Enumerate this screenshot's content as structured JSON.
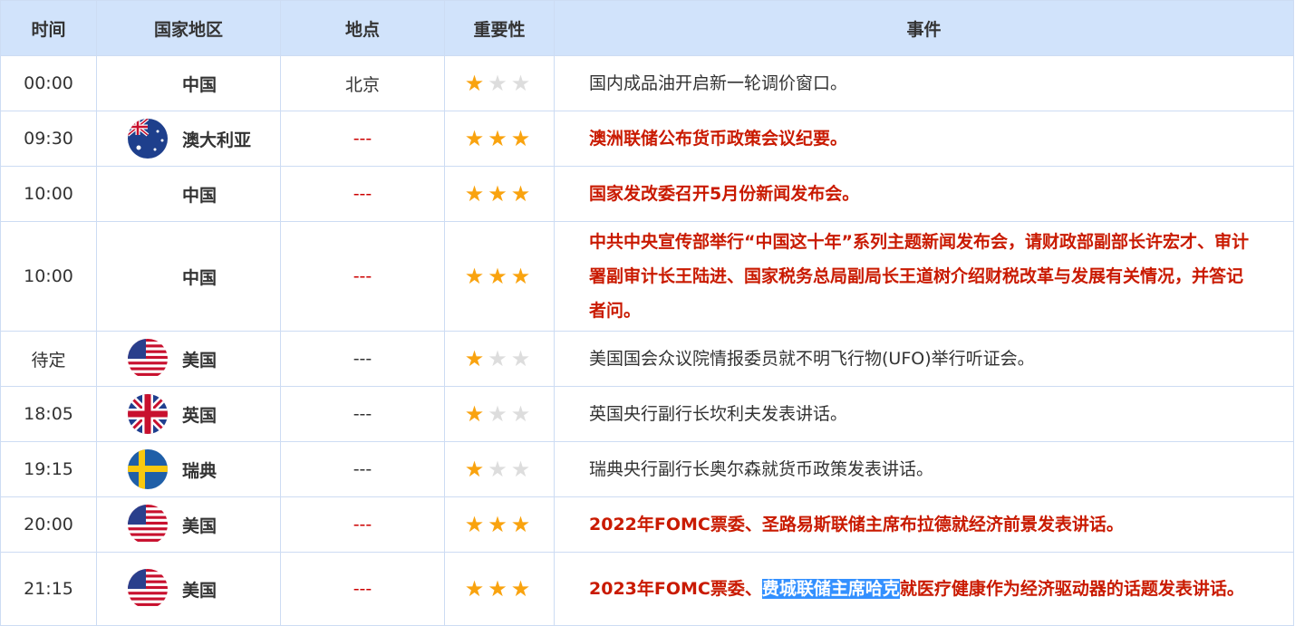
{
  "headers": [
    "时间",
    "国家地区",
    "地点",
    "重要性",
    "事件"
  ],
  "rows": [
    {
      "time": "00:00",
      "country": "中国",
      "flag": "none",
      "location": "北京",
      "stars": 1,
      "important": false,
      "event": "国内成品油开启新一轮调价窗口。"
    },
    {
      "time": "09:30",
      "country": "澳大利亚",
      "flag": "au",
      "location": "---",
      "stars": 3,
      "important": true,
      "event": "澳洲联储公布货币政策会议纪要。"
    },
    {
      "time": "10:00",
      "country": "中国",
      "flag": "none",
      "location": "---",
      "stars": 3,
      "important": true,
      "event": "国家发改委召开5月份新闻发布会。"
    },
    {
      "time": "10:00",
      "country": "中国",
      "flag": "none",
      "location": "---",
      "stars": 3,
      "important": true,
      "event": "中共中央宣传部举行“中国这十年”系列主题新闻发布会，请财政部副部长许宏才、审计署副审计长王陆进、国家税务总局副局长王道树介绍财税改革与发展有关情况，并答记者问。"
    },
    {
      "time": "待定",
      "country": "美国",
      "flag": "us",
      "location": "---",
      "stars": 1,
      "important": false,
      "event": "美国国会众议院情报委员就不明飞行物(UFO)举行听证会。"
    },
    {
      "time": "18:05",
      "country": "英国",
      "flag": "uk",
      "location": "---",
      "stars": 1,
      "important": false,
      "event": "英国央行副行长坎利夫发表讲话。"
    },
    {
      "time": "19:15",
      "country": "瑞典",
      "flag": "se",
      "location": "---",
      "stars": 1,
      "important": false,
      "event": "瑞典央行副行长奥尔森就货币政策发表讲话。"
    },
    {
      "time": "20:00",
      "country": "美国",
      "flag": "us",
      "location": "---",
      "stars": 3,
      "important": true,
      "event": "2022年FOMC票委、圣路易斯联储主席布拉德就经济前景发表讲话。"
    },
    {
      "time": "21:15",
      "country": "美国",
      "flag": "us",
      "location": "---",
      "stars": 3,
      "important": true,
      "event_parts": [
        "2023年FOMC票委、",
        "费城联储主席哈克",
        "就医疗健康作为经济驱动器的话题发表讲话。"
      ]
    }
  ],
  "colors": {
    "header_bg": "#d1e3fb",
    "important": "#c91a00",
    "star": "#f9a30f",
    "selection": "#3390ff"
  }
}
